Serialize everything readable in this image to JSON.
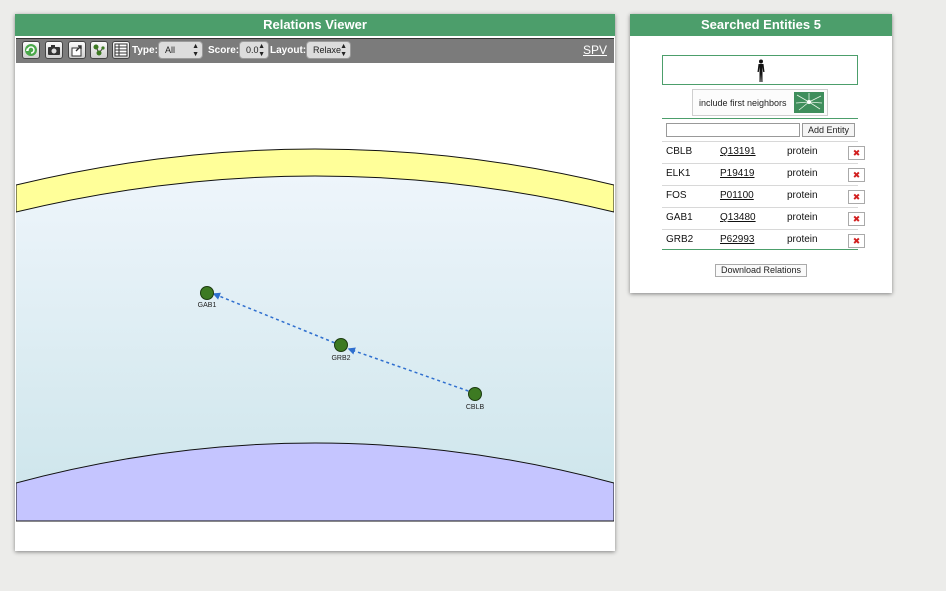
{
  "viewer": {
    "title": "Relations Viewer",
    "toolbar": {
      "type_label": "Type:",
      "type_value": "All",
      "score_label": "Score:",
      "score_value": "0.0",
      "layout_label": "Layout:",
      "layout_value": "Relaxe",
      "spv_link": "SPV"
    },
    "graph": {
      "nodes": [
        {
          "id": "GAB1",
          "label": "GAB1"
        },
        {
          "id": "GRB2",
          "label": "GRB2"
        },
        {
          "id": "CBLB",
          "label": "CBLB"
        }
      ],
      "edges": [
        {
          "from": "GRB2",
          "to": "GAB1",
          "style": "dashed-arrow"
        },
        {
          "from": "CBLB",
          "to": "GRB2",
          "style": "dashed-arrow"
        }
      ],
      "colors": {
        "node": "#3d7a22",
        "edge": "#2f6fcf",
        "membrane": "#ffff99",
        "cytoplasm_top": "#eef5fb",
        "cytoplasm_bottom": "#cfe6ec",
        "nucleus": "#c5c5ff"
      }
    }
  },
  "entities": {
    "title": "Searched Entities 5",
    "include_neighbors_label": "include first neighbors",
    "entity_input_value": "",
    "add_entity_label": "Add Entity",
    "rows": [
      {
        "name": "CBLB",
        "accession": "Q13191",
        "type": "protein"
      },
      {
        "name": "ELK1",
        "accession": "P19419",
        "type": "protein"
      },
      {
        "name": "FOS",
        "accession": "P01100",
        "type": "protein"
      },
      {
        "name": "GAB1",
        "accession": "Q13480",
        "type": "protein"
      },
      {
        "name": "GRB2",
        "accession": "P62993",
        "type": "protein"
      }
    ],
    "download_label": "Download Relations"
  },
  "colors": {
    "accent": "#4c9e6b",
    "delete": "#d21f1f"
  }
}
